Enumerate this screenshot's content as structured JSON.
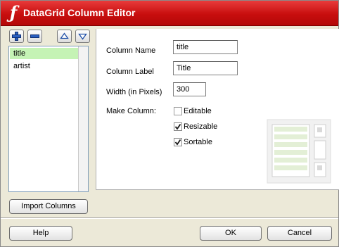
{
  "window": {
    "title": "DataGrid Column Editor"
  },
  "toolbar": {
    "add_icon": "plus-icon",
    "remove_icon": "minus-icon",
    "move_up_icon": "triangle-up-icon",
    "move_down_icon": "triangle-down-icon"
  },
  "columns_list": {
    "items": [
      {
        "label": "title",
        "selected": true
      },
      {
        "label": "artist",
        "selected": false
      }
    ]
  },
  "form": {
    "column_name_label": "Column Name",
    "column_name_value": "title",
    "column_label_label": "Column Label",
    "column_label_value": "Title",
    "width_label": "Width (in Pixels)",
    "width_value": "300",
    "make_column_label": "Make Column:",
    "options": [
      {
        "label": "Editable",
        "checked": false
      },
      {
        "label": "Resizable",
        "checked": true
      },
      {
        "label": "Sortable",
        "checked": true
      }
    ]
  },
  "buttons": {
    "import_columns": "Import Columns",
    "help": "Help",
    "ok": "OK",
    "cancel": "Cancel"
  },
  "colors": {
    "title_bar": "#d01717",
    "selected_row": "#c5f3b5",
    "toolbar_icon": "#1f4fa8"
  }
}
